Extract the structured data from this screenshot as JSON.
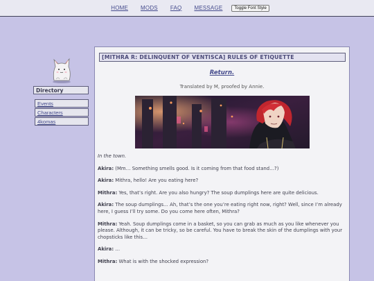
{
  "nav": {
    "links": [
      "HOME",
      "MODS",
      "FAQ",
      "MESSAGE"
    ],
    "toggle_label": "Toggle Font Style"
  },
  "sidebar": {
    "directory_label": "Directory",
    "items": [
      "Events",
      "Characters",
      "4komas"
    ]
  },
  "main": {
    "title": "[MITHRA R: DELINQUENT OF VENTISCA] RULES OF ETIQUETTE",
    "return_label": "Return.",
    "credits": "Translated by M, proofed by Annie.",
    "story": [
      {
        "speaker": "",
        "text": "In the town."
      },
      {
        "speaker": "Akira:",
        "text": "(Mm… Something smells good. Is it coming from that food stand…?)"
      },
      {
        "speaker": "Akira:",
        "text": "Mithra, hello! Are you eating here?"
      },
      {
        "speaker": "Mithra:",
        "text": "Yes, that’s right. Are you also hungry? The soup dumplings here are quite delicious."
      },
      {
        "speaker": "Akira:",
        "text": "The soup dumplings… Ah, that’s the one you’re eating right now, right? Well, since I’m already here, I guess I’ll try some. Do you come here often, Mithra?"
      },
      {
        "speaker": "Mithra:",
        "text": "Yeah. Soup dumplings come in a basket, so you can grab as much as you like whenever you please. Although, it can be tricky, so be careful. You have to break the skin of the dumplings with your chopsticks like this…"
      },
      {
        "speaker": "Akira:",
        "text": "…"
      },
      {
        "speaker": "Mithra:",
        "text": "What is with the shocked expression?"
      }
    ]
  },
  "colors": {
    "background": "#c6c3e6",
    "link": "#444a8c",
    "panel": "#f3f3f6"
  }
}
